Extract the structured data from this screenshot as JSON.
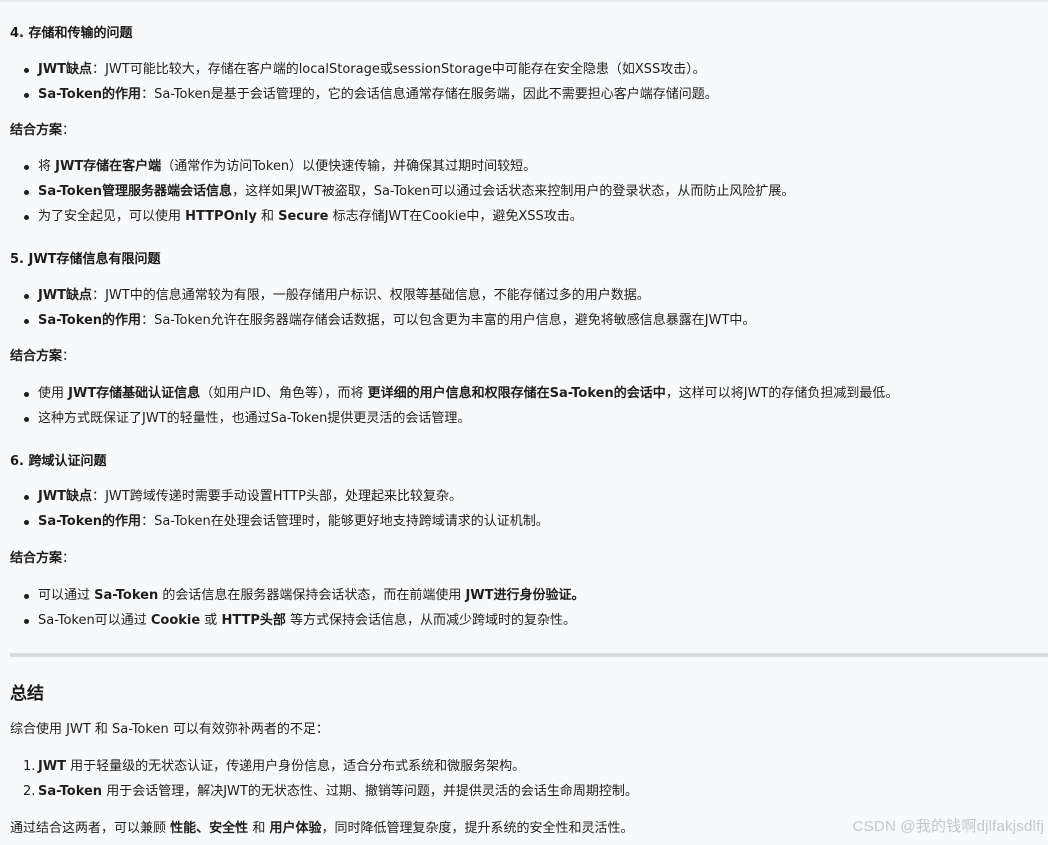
{
  "s4": {
    "heading": "4. 存储和传输的问题",
    "items": [
      {
        "label": "JWT缺点",
        "sep": "：",
        "text": "JWT可能比较大，存储在客户端的localStorage或sessionStorage中可能存在安全隐患（如XSS攻击）。"
      },
      {
        "label": "Sa-Token的作用",
        "sep": "：",
        "text": "Sa-Token是基于会话管理的，它的会话信息通常存储在服务端，因此不需要担心客户端存储问题。"
      }
    ],
    "solution_label": "结合方案",
    "solution_colon": "：",
    "solutions": [
      {
        "pre": "将 ",
        "bold": "JWT存储在客户端",
        "post": "（通常作为访问Token）以便快速传输，并确保其过期时间较短。"
      },
      {
        "pre": "",
        "bold": "Sa-Token管理服务器端会话信息",
        "post": "，这样如果JWT被盗取，Sa-Token可以通过会话状态来控制用户的登录状态，从而防止风险扩展。"
      },
      {
        "pre": "为了安全起见，可以使用 ",
        "bold": "HTTPOnly",
        "mid": " 和 ",
        "bold2": "Secure",
        "post": " 标志存储JWT在Cookie中，避免XSS攻击。"
      }
    ]
  },
  "s5": {
    "heading": "5. JWT存储信息有限问题",
    "items": [
      {
        "label": "JWT缺点",
        "sep": "：",
        "text": "JWT中的信息通常较为有限，一般存储用户标识、权限等基础信息，不能存储过多的用户数据。"
      },
      {
        "label": "Sa-Token的作用",
        "sep": "：",
        "text": "Sa-Token允许在服务器端存储会话数据，可以包含更为丰富的用户信息，避免将敏感信息暴露在JWT中。"
      }
    ],
    "solution_label": "结合方案",
    "solution_colon": "：",
    "solutions": [
      {
        "pre": "使用 ",
        "bold": "JWT存储基础认证信息",
        "mid": "（如用户ID、角色等），而将 ",
        "bold2": "更详细的用户信息和权限存储在Sa-Token的会话中",
        "post": "，这样可以将JWT的存储负担减到最低。"
      },
      {
        "pre": "这种方式既保证了JWT的轻量性，也通过Sa-Token提供更灵活的会话管理。"
      }
    ]
  },
  "s6": {
    "heading": "6. 跨域认证问题",
    "items": [
      {
        "label": "JWT缺点",
        "sep": "：",
        "text": "JWT跨域传递时需要手动设置HTTP头部，处理起来比较复杂。"
      },
      {
        "label": "Sa-Token的作用",
        "sep": "：",
        "text": "Sa-Token在处理会话管理时，能够更好地支持跨域请求的认证机制。"
      }
    ],
    "solution_label": "结合方案",
    "solution_colon": "：",
    "solutions": [
      {
        "pre": "可以通过 ",
        "bold": "Sa-Token",
        "mid": " 的会话信息在服务器端保持会话状态，而在前端使用 ",
        "bold2": "JWT进行身份验证。",
        "post": ""
      },
      {
        "pre": "Sa-Token可以通过 ",
        "bold": "Cookie",
        "mid": " 或 ",
        "bold2": "HTTP头部",
        "post": " 等方式保持会话信息，从而减少跨域时的复杂性。"
      }
    ]
  },
  "summary": {
    "heading": "总结",
    "intro": "综合使用 JWT 和 Sa-Token 可以有效弥补两者的不足：",
    "items": [
      {
        "num": "1.",
        "label": "JWT",
        "text": " 用于轻量级的无状态认证，传递用户身份信息，适合分布式系统和微服务架构。"
      },
      {
        "num": "2.",
        "label": "Sa-Token",
        "text": " 用于会话管理，解决JWT的无状态性、过期、撤销等问题，并提供灵活的会话生命周期控制。"
      }
    ],
    "conclusion": {
      "pre": "通过结合这两者，可以兼顾 ",
      "b1": "性能",
      "s1": "、",
      "b2": "安全性",
      "s2": " 和 ",
      "b3": "用户体验",
      "post": "，同时降低管理复杂度，提升系统的安全性和灵活性。"
    }
  },
  "watermark": "CSDN @我的钱啊djlfakjsdlfj"
}
